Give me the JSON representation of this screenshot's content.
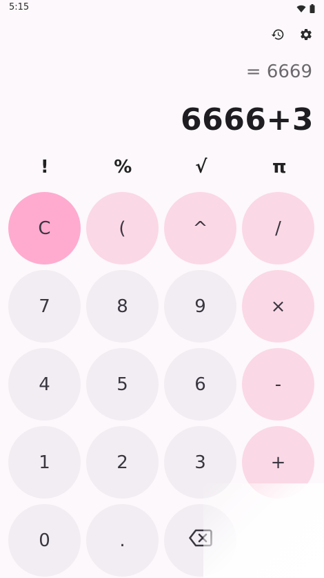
{
  "status_bar": {
    "time": "5:15",
    "icons": [
      "wifi-icon",
      "battery-icon"
    ]
  },
  "toolbar": {
    "icons": [
      "history-icon",
      "settings-gear-icon"
    ]
  },
  "display": {
    "result": "= 6669",
    "expression": "6666+3"
  },
  "function_row": [
    {
      "label": "!"
    },
    {
      "label": "%"
    },
    {
      "label": "√"
    },
    {
      "label": "π"
    }
  ],
  "keys": {
    "clear": "C",
    "paren": "(",
    "power": "^",
    "divide": "/",
    "seven": "7",
    "eight": "8",
    "nine": "9",
    "multiply": "×",
    "four": "4",
    "five": "5",
    "six": "6",
    "minus": "-",
    "one": "1",
    "two": "2",
    "three": "3",
    "plus": "+",
    "zero": "0",
    "dot": "."
  },
  "colors": {
    "background": "#fcf8fb",
    "number_key": "#f1edf2",
    "operator_key": "#fbd8e5",
    "clear_key": "#ffabd0",
    "text": "#3a3640"
  }
}
